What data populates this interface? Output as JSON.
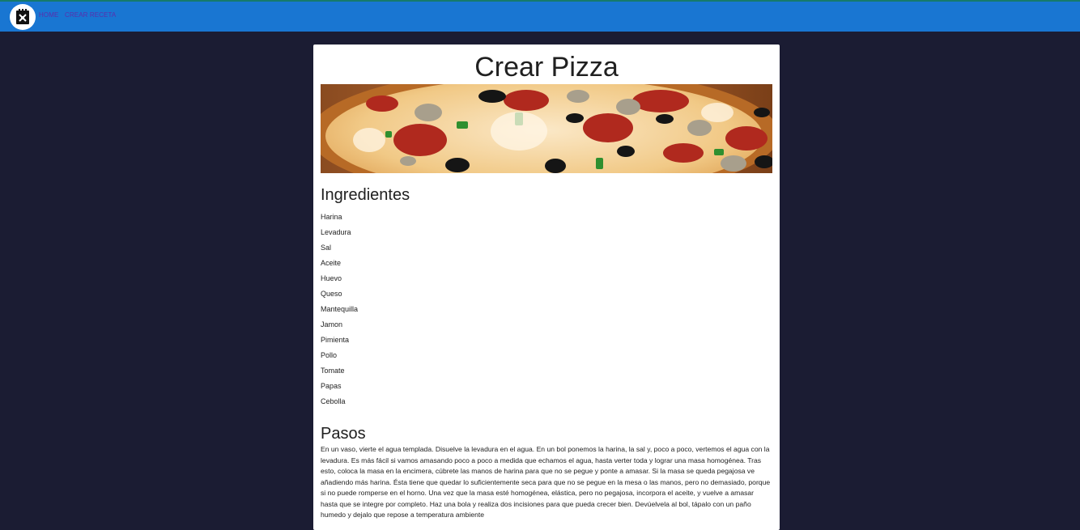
{
  "nav": {
    "home": "HOME",
    "create": "CREAR RECETA",
    "logo_icon": "chef-logo-icon"
  },
  "recipe": {
    "title": "Crear Pizza",
    "ingredients_title": "Ingredientes",
    "ingredients": [
      "Harina",
      "Levadura",
      "Sal",
      "Aceite",
      "Huevo",
      "Queso",
      "Mantequilla",
      "Jamon",
      "Pimienta",
      "Pollo",
      "Tomate",
      "Papas",
      "Cebolla"
    ],
    "steps_title": "Pasos",
    "steps_text": "En un vaso, vierte el agua templada. Disuelve la levadura en el agua. En un bol ponemos la harina, la sal y, poco a poco, vertemos el agua con la levadura. Es más fácil si vamos amasando poco a poco a medida que echamos el agua, hasta verter toda y lograr una masa homogénea. Tras esto, coloca la masa en la encimera, cúbrete las manos de harina para que no se pegue y ponte a amasar. Si la masa se queda pegajosa ve añadiendo más harina. Ésta tiene que quedar lo suficientemente seca para que no se pegue en la mesa o las manos, pero no demasiado, porque si no puede romperse en el horno. Una vez que la masa esté homogénea, elástica, pero no pegajosa, incorpora el aceite, y vuelve a amasar hasta que se integre por completo. Haz una bola y realiza dos incisiones para que pueda crecer bien. Devúelvela al bol, tápalo con un paño humedo y dejalo que repose a temperatura ambiente"
  },
  "colors": {
    "page_background": "#1b1c33",
    "navbar": "#1976d2",
    "nav_link": "#5b2dac",
    "card": "#ffffff"
  }
}
